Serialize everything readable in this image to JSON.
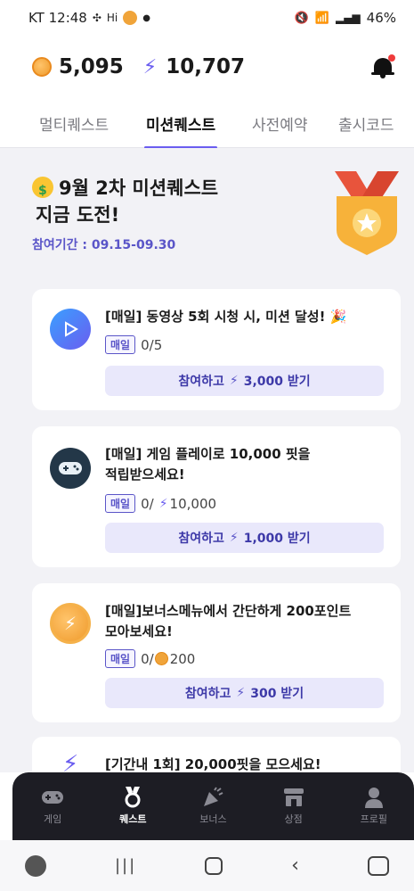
{
  "status_bar": {
    "time": "KT 12:48",
    "extra": "Hi",
    "battery": "46%"
  },
  "header": {
    "coin_points": "5,095",
    "bolt_points": "10,707"
  },
  "tabs": [
    {
      "label": "멀티퀘스트",
      "active": false
    },
    {
      "label": "미션퀘스트",
      "active": true
    },
    {
      "label": "사전예약",
      "active": false
    },
    {
      "label": "출시코드",
      "active": false
    }
  ],
  "banner": {
    "title_line1": "9월 2차 미션퀘스트",
    "title_line2": "지금 도전!",
    "period": "참여기간 : 09.15-09.30"
  },
  "missions": [
    {
      "title_line1": "[매일] 동영상 5회 시청 시, 미션 달성! 🎉",
      "title_line2": "",
      "tag": "매일",
      "progress": "0/5",
      "button_label": "참여하고",
      "button_reward": "3,000 받기",
      "icon": "play-icon"
    },
    {
      "title_line1": "[매일] 게임 플레이로 10,000 핏을",
      "title_line2": "적립받으세요!",
      "tag": "매일",
      "progress_prefix": "0/",
      "progress_value": "10,000",
      "button_label": "참여하고",
      "button_reward": "1,000 받기",
      "icon": "gamepad-icon"
    },
    {
      "title_line1": "[매일]보너스메뉴에서 간단하게 200포인트",
      "title_line2": "모아보세요!",
      "tag": "매일",
      "progress_prefix": "0/",
      "progress_value": "200",
      "button_label": "참여하고",
      "button_reward": "300 받기",
      "icon": "coin-icon"
    },
    {
      "title_line1": "[기간내 1회] 20,000핏을 모으세요!",
      "icon": "bolt-icon"
    }
  ],
  "bottom_nav": [
    {
      "label": "게임",
      "icon": "gamepad-icon",
      "active": false
    },
    {
      "label": "퀘스트",
      "icon": "medal-icon",
      "active": true
    },
    {
      "label": "보너스",
      "icon": "party-icon",
      "active": false
    },
    {
      "label": "상점",
      "icon": "store-icon",
      "active": false
    },
    {
      "label": "프로필",
      "icon": "profile-icon",
      "active": false
    }
  ],
  "colors": {
    "accent": "#6a5df0",
    "tag": "#5a55c8",
    "button_bg": "#e9e8fb",
    "page_bg": "#f2f2f6",
    "nav_bg": "#1d1d24"
  }
}
